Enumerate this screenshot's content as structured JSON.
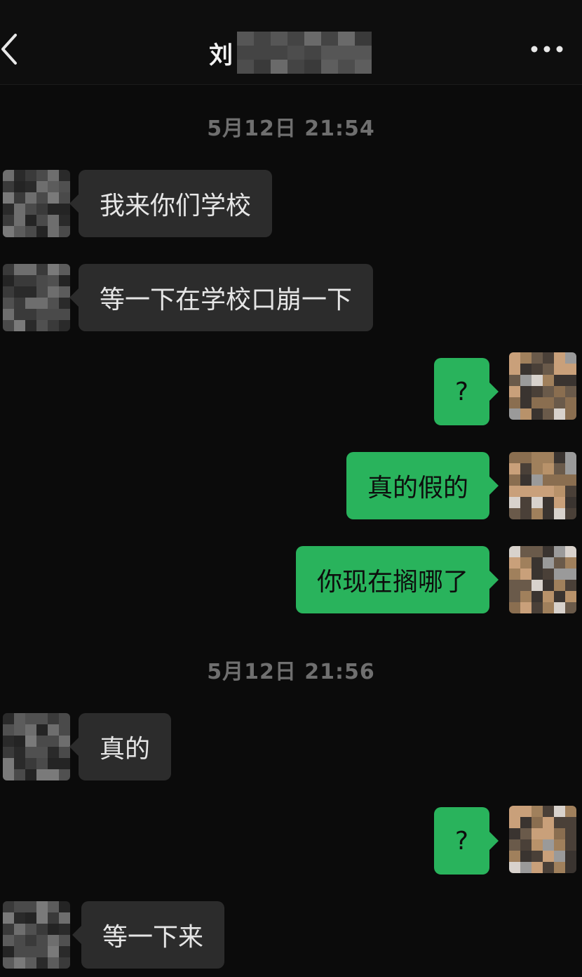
{
  "header": {
    "back_icon": "chevron-left-icon",
    "title_visible": "刘",
    "more_icon": "more-horizontal-icon"
  },
  "timestamps": [
    "5月12日 21:54",
    "5月12日 21:56"
  ],
  "messages": [
    {
      "sender": "other",
      "text": "我来你们学校"
    },
    {
      "sender": "other",
      "text": "等一下在学校口崩一下"
    },
    {
      "sender": "me",
      "text": "?"
    },
    {
      "sender": "me",
      "text": "真的假的"
    },
    {
      "sender": "me",
      "text": "你现在搁哪了"
    },
    {
      "sender": "other",
      "text": "真的"
    },
    {
      "sender": "me",
      "text": "?"
    },
    {
      "sender": "other",
      "text": "等一下来"
    }
  ],
  "colors": {
    "background": "#0b0b0b",
    "incoming_bubble": "#2c2c2c",
    "outgoing_bubble": "#29b35c",
    "timestamp": "#6f6f6f"
  }
}
